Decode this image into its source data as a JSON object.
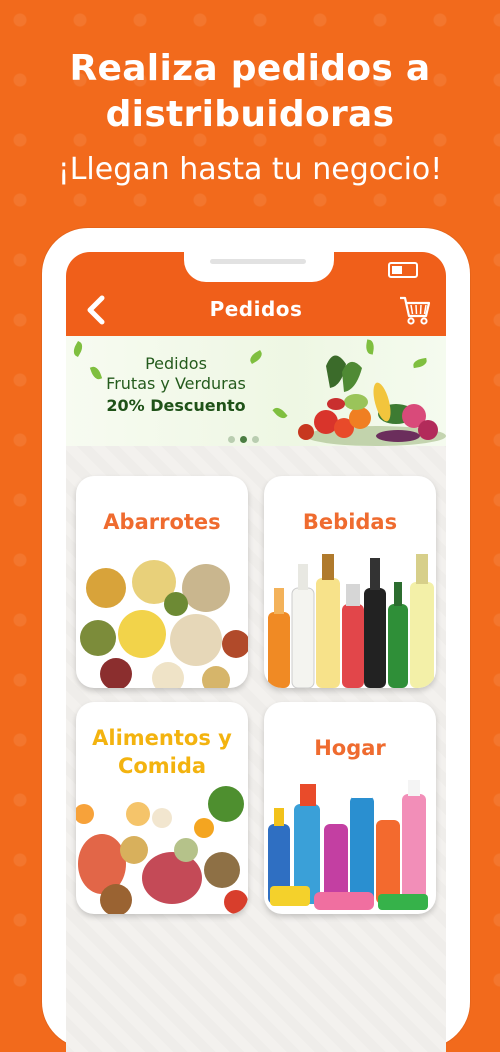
{
  "headline": {
    "line1": "Realiza pedidos a",
    "line2": "distribuidoras",
    "subtitle": "¡Llegan hasta tu negocio!"
  },
  "app": {
    "title": "Pedidos",
    "back_icon": "chevron-left-icon",
    "cart_icon": "shopping-cart-icon"
  },
  "banner": {
    "line1": "Pedidos",
    "line2": "Frutas y Verduras",
    "line3": "20% Descuento",
    "slides": 3,
    "active_slide": 2
  },
  "categories": [
    {
      "label": "Abarrotes"
    },
    {
      "label": "Bebidas"
    },
    {
      "label_1": "Alimentos y",
      "label_2": "Comida"
    },
    {
      "label": "Hogar"
    }
  ],
  "colors": {
    "brand_orange": "#f26a1c",
    "appbar_orange": "#f05f1a",
    "category_orange": "#ef6b2f",
    "category_yellow": "#f3b30f",
    "banner_green": "#1f5218"
  }
}
